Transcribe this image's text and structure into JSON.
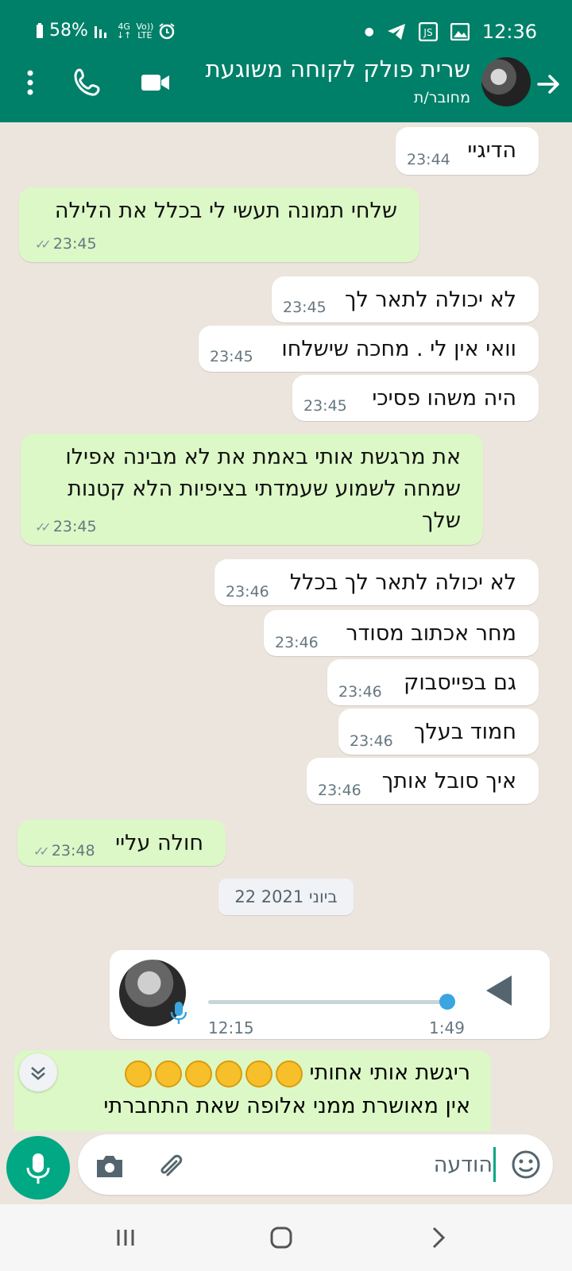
{
  "status_bar": {
    "battery": "58%",
    "network_top": "4G",
    "volte_top": "Vo))",
    "volte_bottom": "LTE",
    "time": "12:36"
  },
  "header": {
    "contact_name": "שרית פולק לקוחה משוגעת",
    "contact_status": "מחובר/ת"
  },
  "messages": [
    {
      "dir": "in",
      "text": "הדיגיי",
      "time": "23:44"
    },
    {
      "dir": "out",
      "text": "שלחי תמונה תעשי לי בכלל את הלילה",
      "time": "23:45"
    },
    {
      "dir": "in",
      "text": "לא יכולה לתאר לך",
      "time": "23:45"
    },
    {
      "dir": "in",
      "text": "וואי אין לי . מחכה שישלחו",
      "time": "23:45"
    },
    {
      "dir": "in",
      "text": "היה משהו פסיכי",
      "time": "23:45"
    },
    {
      "dir": "out",
      "text": "את מרגשת אותי באמת את לא מבינה אפילו\nשמחה לשמוע שעמדתי בציפיות הלא קטנות\nשלך",
      "time": "23:45"
    },
    {
      "dir": "in",
      "text": "לא יכולה לתאר לך בכלל",
      "time": "23:46"
    },
    {
      "dir": "in",
      "text": "מחר אכתוב מסודר",
      "time": "23:46"
    },
    {
      "dir": "in",
      "text": "גם בפייסבוק",
      "time": "23:46"
    },
    {
      "dir": "in",
      "text": "חמוד בעלך",
      "time": "23:46"
    },
    {
      "dir": "in",
      "text": "איך סובל אותך",
      "time": "23:46"
    },
    {
      "dir": "out",
      "text": "חולה עליי",
      "time": "23:48"
    }
  ],
  "date_divider": "22 ביוני 2021",
  "voice_message": {
    "duration": "1:49",
    "time": "12:15",
    "progress": 0.97
  },
  "partial_message": {
    "line1": "ריגשת אותי אחותי",
    "line2": "אין מאושרת ממני אלופה שאת התחברתי",
    "emoji_count": 6
  },
  "input": {
    "placeholder": "הודעה"
  },
  "colors": {
    "header": "#008069",
    "outgoing_bubble": "#dcf8c6",
    "incoming_bubble": "#ffffff",
    "accent": "#00a884"
  }
}
